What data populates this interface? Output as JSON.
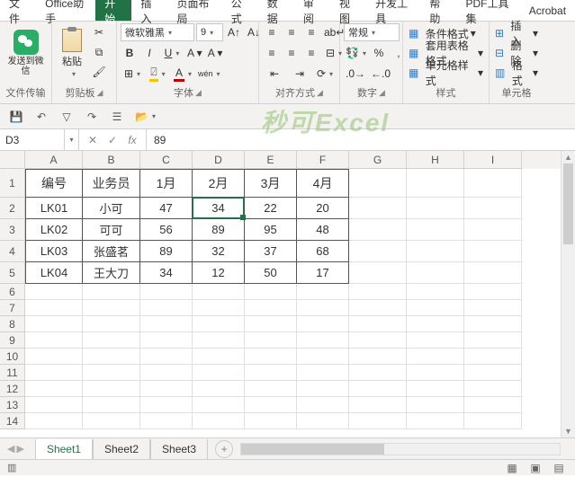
{
  "menu": {
    "items": [
      "文件",
      "Office助手",
      "开始",
      "插入",
      "页面布局",
      "公式",
      "数据",
      "审阅",
      "视图",
      "开发工具",
      "帮助",
      "PDF工具集",
      "Acrobat"
    ],
    "active_index": 2
  },
  "ribbon": {
    "group1": {
      "send_wechat": "发送到微信",
      "label": "文件传输"
    },
    "clipboard": {
      "paste": "粘贴",
      "label": "剪贴板"
    },
    "font": {
      "name": "微软雅黑",
      "size": "9",
      "bold": "B",
      "italic": "I",
      "underline": "U",
      "border": "⊞",
      "fill": "A",
      "color": "A",
      "ruby": "wén",
      "label": "字体"
    },
    "align": {
      "label": "对齐方式"
    },
    "number": {
      "format": "常规",
      "label": "数字"
    },
    "styles": {
      "cond": "条件格式",
      "table": "套用表格格式",
      "cell": "单元格样式",
      "label": "样式"
    },
    "cells": {
      "insert": "插入",
      "delete": "删除",
      "format": "格式",
      "label": "单元格"
    }
  },
  "qat": {
    "items": [
      "save",
      "undo",
      "redo",
      "filter",
      "refresh",
      "open"
    ]
  },
  "formula": {
    "cell_ref": "D3",
    "value": "89"
  },
  "grid": {
    "cols": [
      "A",
      "B",
      "C",
      "D",
      "E",
      "F",
      "G",
      "H",
      "I"
    ],
    "rows_visible": 14,
    "headers": [
      "编号",
      "业务员",
      "1月",
      "2月",
      "3月",
      "4月"
    ],
    "data": [
      [
        "LK01",
        "小可",
        "47",
        "34",
        "22",
        "20"
      ],
      [
        "LK02",
        "可可",
        "56",
        "89",
        "95",
        "48"
      ],
      [
        "LK03",
        "张盛茗",
        "89",
        "32",
        "37",
        "68"
      ],
      [
        "LK04",
        "王大刀",
        "34",
        "12",
        "50",
        "17"
      ]
    ]
  },
  "sheets": {
    "tabs": [
      "Sheet1",
      "Sheet2",
      "Sheet3"
    ],
    "active": 0
  },
  "watermark": "秒可Excel",
  "chart_data": {
    "type": "table",
    "title": "",
    "columns": [
      "编号",
      "业务员",
      "1月",
      "2月",
      "3月",
      "4月"
    ],
    "rows": [
      {
        "编号": "LK01",
        "业务员": "小可",
        "1月": 47,
        "2月": 34,
        "3月": 22,
        "4月": 20
      },
      {
        "编号": "LK02",
        "业务员": "可可",
        "1月": 56,
        "2月": 89,
        "3月": 95,
        "4月": 48
      },
      {
        "编号": "LK03",
        "业务员": "张盛茗",
        "1月": 89,
        "2月": 32,
        "3月": 37,
        "4月": 68
      },
      {
        "编号": "LK04",
        "业务员": "王大刀",
        "1月": 34,
        "2月": 12,
        "3月": 50,
        "4月": 17
      }
    ]
  }
}
